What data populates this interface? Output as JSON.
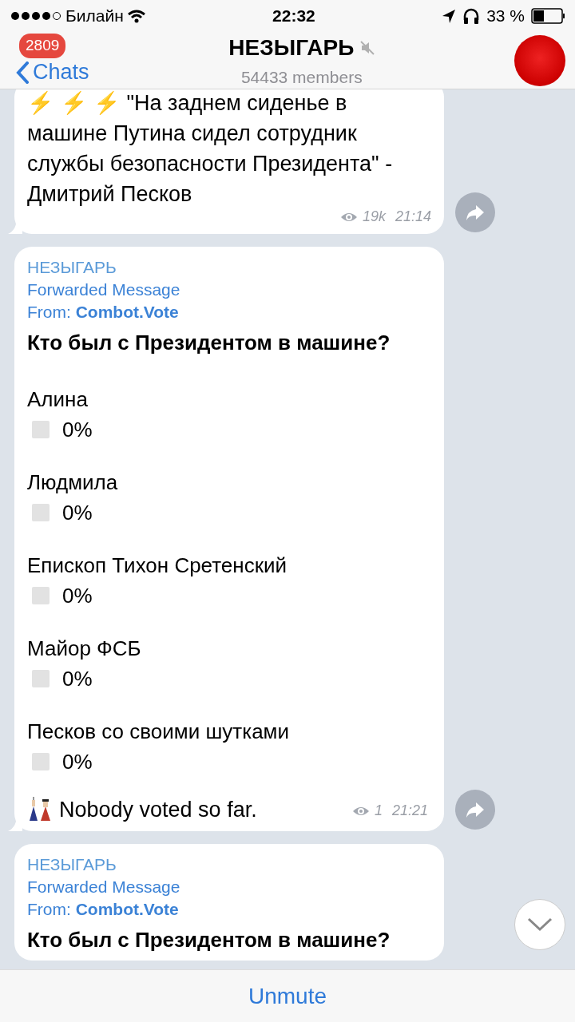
{
  "status_bar": {
    "carrier": "Билайн",
    "time": "22:32",
    "battery": "33 %"
  },
  "header": {
    "back_label": "Chats",
    "unread_badge": "2809",
    "title": "НЕЗЫГАРЬ",
    "muted": true,
    "subtitle": "54433 members"
  },
  "messages": [
    {
      "kind": "text",
      "text": "⚡ ⚡ ⚡ \"На заднем сиденье в машине Путина сидел сотрудник службы безопасности Президента\" - Дмитрий Песков",
      "views": "19k",
      "time": "21:14",
      "tail": true,
      "share": true
    },
    {
      "kind": "poll",
      "sender": "НЕЗЫГАРЬ",
      "forwarded": "Forwarded Message",
      "from_label": "From:",
      "from_name": "Combot.Vote",
      "question": "Кто был с Президентом в машине?",
      "options": [
        {
          "label": "Алина",
          "checked": false,
          "percent": "0%"
        },
        {
          "label": "Людмила",
          "checked": false,
          "percent": "0%"
        },
        {
          "label": "Епископ Тихон Сретенский",
          "checked": false,
          "percent": "0%"
        },
        {
          "label": "Майор ФСБ",
          "checked": false,
          "percent": "0%"
        },
        {
          "label": "Песков со своими шутками",
          "checked": false,
          "percent": "0%"
        }
      ],
      "footer": "Nobody voted so far.",
      "views": "1",
      "time": "21:21",
      "tail": true,
      "share": true
    },
    {
      "kind": "poll",
      "sender": "НЕЗЫГАРЬ",
      "forwarded": "Forwarded Message",
      "from_label": "From:",
      "from_name": "Combot.Vote",
      "question": "Кто был с Президентом в машине?",
      "tail": false
    }
  ],
  "bottom_bar": {
    "button": "Unmute"
  }
}
